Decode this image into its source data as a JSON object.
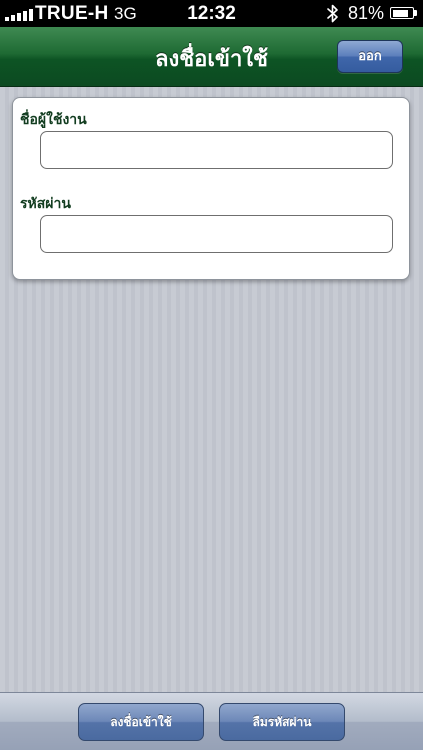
{
  "status_bar": {
    "carrier": "TRUE-H",
    "network": "3G",
    "time": "12:32",
    "battery_percent": "81%",
    "battery_level": 0.81,
    "bluetooth_icon": "bluetooth-icon"
  },
  "nav_bar": {
    "title": "ลงชื่อเข้าใช้",
    "exit_label": "ออก"
  },
  "form": {
    "username_label": "ชื่อผู้ใช้งาน",
    "username_value": "",
    "username_placeholder": "",
    "password_label": "รหัสผ่าน",
    "password_value": "",
    "password_placeholder": ""
  },
  "toolbar": {
    "login_label": "ลงชื่อเข้าใช้",
    "forgot_label": "ลืมรหัสผ่าน"
  },
  "colors": {
    "nav_green": "#0d5424",
    "label_green": "#123d20",
    "button_blue": "#5473a8"
  }
}
